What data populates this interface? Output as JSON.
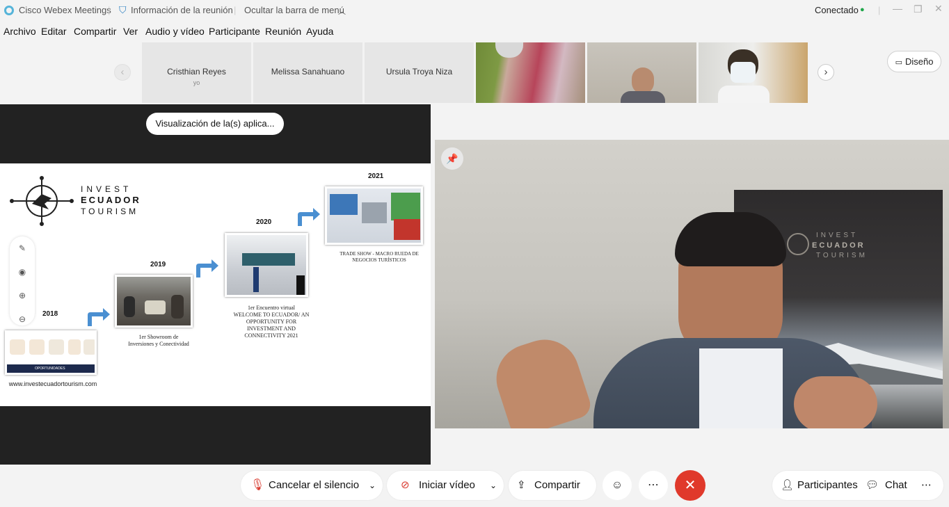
{
  "titlebar": {
    "app_title": "Cisco Webex Meetings",
    "meeting_info": "Información de la reunión",
    "hide_menu": "Ocultar la barra de menú",
    "status": "Conectado"
  },
  "menu": [
    "Archivo",
    "Editar",
    "Compartir",
    "Ver",
    "Audio y vídeo",
    "Participante",
    "Reunión",
    "Ayuda"
  ],
  "participants": [
    {
      "name": "Cristhian Reyes",
      "sub": "yo"
    },
    {
      "name": "Melissa Sanahuano",
      "sub": ""
    },
    {
      "name": "Ursula Troya Niza",
      "sub": ""
    }
  ],
  "layout_button": "Diseño",
  "share": {
    "view_pill": "Visualización de la(s) aplica...",
    "slide": {
      "brand": [
        "INVEST",
        "ECUADOR",
        "TOURISM"
      ],
      "years": [
        "2018",
        "2019",
        "2020",
        "2021"
      ],
      "caption_2019": [
        "1er Showroom de",
        "Inversiones y Conectividad"
      ],
      "caption_2020": [
        "1er Encuentro virtual",
        "WELCOME TO ECUADOR/ AN",
        "OPPORTUNITY FOR",
        "INVESTMENT AND",
        "CONNECTIVITY 2021"
      ],
      "caption_2021": [
        "TRADE SHOW - MACRO RUEDA DE",
        "NEGOCIOS TURÍSTICOS"
      ],
      "website": "www.investecuadortourism.com",
      "doc_label": "OPORTUNIDADES"
    }
  },
  "video": {
    "banner": [
      "INVEST",
      "ECUADOR",
      "TOURISM"
    ]
  },
  "toolbar": {
    "mute": "Cancelar el silencio",
    "video": "Iniciar vídeo",
    "share": "Compartir",
    "participants": "Participantes",
    "chat": "Chat"
  },
  "colors": {
    "end_call": "#e0392b",
    "status_dot": "#1fa64a",
    "arrow_blue": "#4a8fd1"
  }
}
